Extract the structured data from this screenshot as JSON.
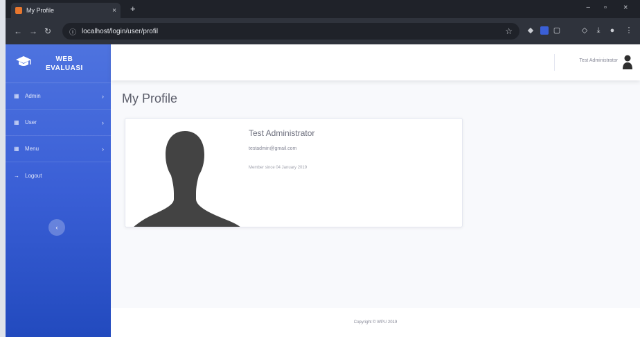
{
  "browser": {
    "tab_title": "My Profile",
    "tab_close": "×",
    "new_tab": "+",
    "url": "localhost/login/user/profil",
    "minimize": "−",
    "maximize": "▫",
    "close": "×"
  },
  "sidebar": {
    "brand_line1": "WEB",
    "brand_line2": "EVALUASI",
    "items": [
      {
        "label": "Admin",
        "icon": "▦",
        "chevron": "›"
      },
      {
        "label": "User",
        "icon": "▦",
        "chevron": "›"
      },
      {
        "label": "Menu",
        "icon": "▦",
        "chevron": "›"
      }
    ],
    "logout_label": "Logout",
    "logout_icon": "→",
    "toggle_icon": "‹"
  },
  "topbar": {
    "user_name": "Test Administrator"
  },
  "page": {
    "title": "My Profile"
  },
  "profile": {
    "name": "Test Administrator",
    "email": "testadmin@gmail.com",
    "member_since": "Member since 04 January 2019"
  },
  "footer": {
    "text": "Copyright © WPU 2019"
  },
  "colors": {
    "sidebar_top": "#4e73df",
    "sidebar_bottom": "#224abe",
    "background": "#f8f9fc",
    "silhouette": "#434343"
  }
}
